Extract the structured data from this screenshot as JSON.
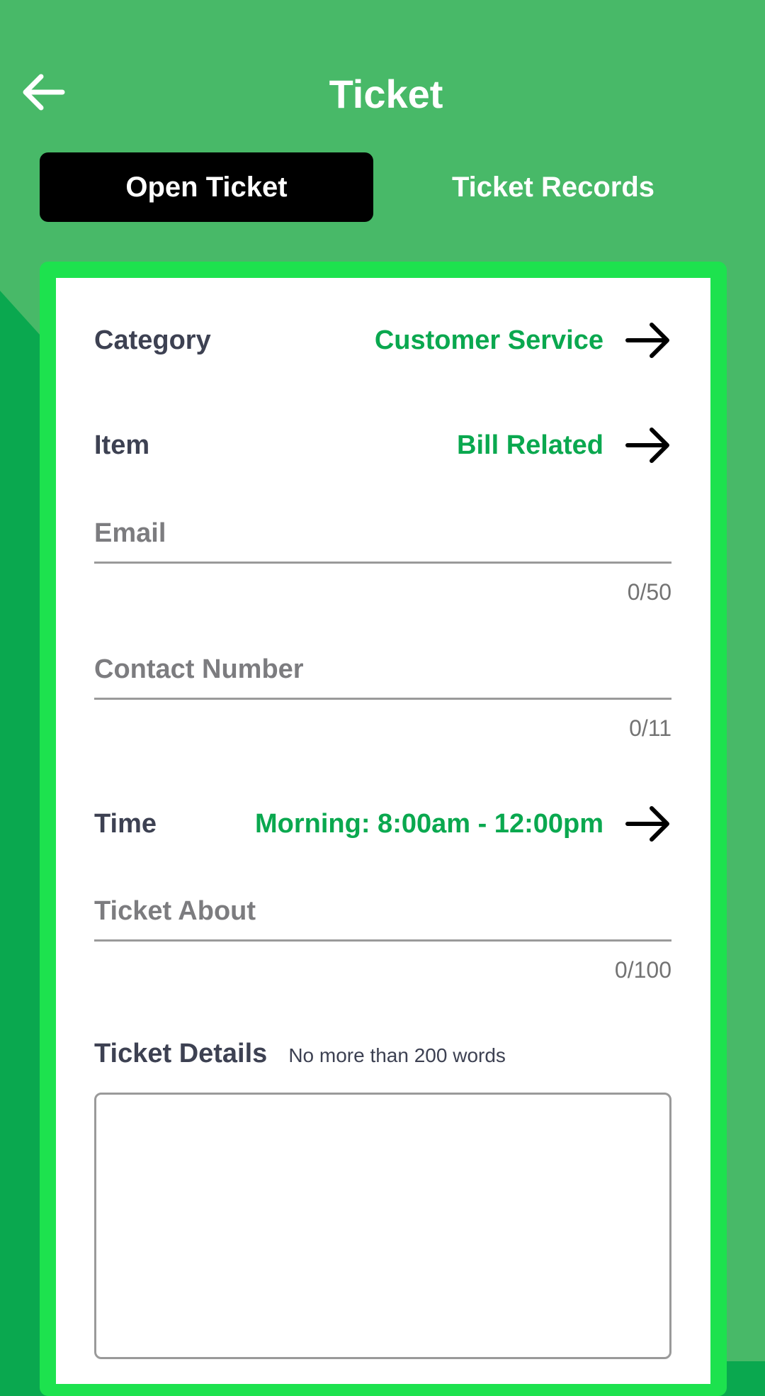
{
  "header": {
    "title": "Ticket",
    "back_icon": "arrow-left-icon"
  },
  "tabs": [
    {
      "label": "Open Ticket",
      "active": true
    },
    {
      "label": "Ticket Records",
      "active": false
    }
  ],
  "form": {
    "category": {
      "label": "Category",
      "value": "Customer Service",
      "icon": "arrow-right-icon"
    },
    "item": {
      "label": "Item",
      "value": "Bill Related",
      "icon": "arrow-right-icon"
    },
    "email": {
      "placeholder": "Email",
      "value": "",
      "counter": "0/50"
    },
    "contact_number": {
      "placeholder": "Contact Number",
      "value": "",
      "counter": "0/11"
    },
    "time": {
      "label": "Time",
      "value": "Morning: 8:00am - 12:00pm",
      "icon": "arrow-right-icon"
    },
    "ticket_about": {
      "placeholder": "Ticket About",
      "value": "",
      "counter": "0/100"
    },
    "ticket_details": {
      "label": "Ticket Details",
      "hint": "No more than 200 words",
      "value": ""
    }
  },
  "colors": {
    "background": "#48b968",
    "background_shape": "#0aa84f",
    "card_border": "#1de24e",
    "active_tab": "#000000",
    "accent_value": "#0aa84f",
    "label_text": "#3d4152"
  }
}
